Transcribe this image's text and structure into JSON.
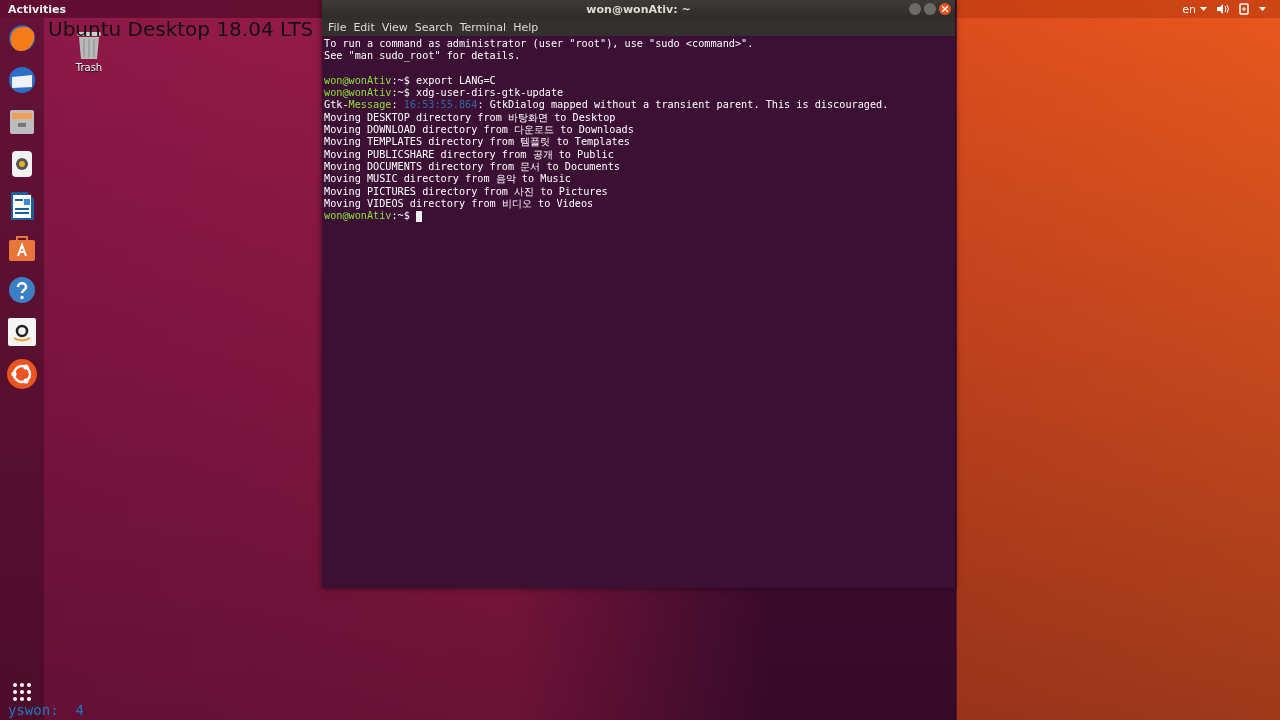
{
  "overlay": {
    "caption": "Ubuntu Desktop 18.04 LTS",
    "counter": "yswon:  4"
  },
  "top_bar": {
    "activities": "Activities",
    "language": "en"
  },
  "dock": {
    "apps": [
      {
        "kind": "firefox"
      },
      {
        "kind": "mail"
      },
      {
        "kind": "files"
      },
      {
        "kind": "music"
      },
      {
        "kind": "writer"
      },
      {
        "kind": "software"
      },
      {
        "kind": "help"
      },
      {
        "kind": "amazon"
      },
      {
        "kind": "ubuntu"
      }
    ]
  },
  "desktop": {
    "icons": [
      {
        "label": "Trash"
      }
    ]
  },
  "terminal": {
    "title": "won@wonAtiv: ~",
    "menu": [
      "File",
      "Edit",
      "View",
      "Search",
      "Terminal",
      "Help"
    ],
    "lines": [
      {
        "kind": "output",
        "segments": [
          {
            "text": "To run a command as administrator (user \"root\"), use \"sudo <command>\".",
            "kind": "plain"
          }
        ]
      },
      {
        "kind": "output",
        "segments": [
          {
            "text": "See \"man sudo_root\" for details.",
            "kind": "plain"
          }
        ]
      },
      {
        "kind": "blank"
      },
      {
        "kind": "output",
        "segments": [
          {
            "text": "won@wonAtiv",
            "kind": "user"
          },
          {
            "text": ":~$ export LANG=C",
            "kind": "plain"
          }
        ]
      },
      {
        "kind": "output",
        "segments": [
          {
            "text": "won@wonAtiv",
            "kind": "user"
          },
          {
            "text": ":~$ xdg-user-dirs-gtk-update",
            "kind": "plain"
          }
        ]
      },
      {
        "kind": "output",
        "segments": [
          {
            "text": "Gtk-",
            "kind": "plain"
          },
          {
            "text": "Message",
            "kind": "user"
          },
          {
            "text": ": ",
            "kind": "plain"
          },
          {
            "text": "16:53:55.864",
            "kind": "time"
          },
          {
            "text": ": GtkDialog mapped without a transient parent. This is discouraged.",
            "kind": "plain"
          }
        ]
      },
      {
        "kind": "output",
        "segments": [
          {
            "text": "Moving DESKTOP directory from 바탕화면 to Desktop",
            "kind": "plain"
          }
        ]
      },
      {
        "kind": "output",
        "segments": [
          {
            "text": "Moving DOWNLOAD directory from 다운로드 to Downloads",
            "kind": "plain"
          }
        ]
      },
      {
        "kind": "output",
        "segments": [
          {
            "text": "Moving TEMPLATES directory from 템플릿 to Templates",
            "kind": "plain"
          }
        ]
      },
      {
        "kind": "output",
        "segments": [
          {
            "text": "Moving PUBLICSHARE directory from 공개 to Public",
            "kind": "plain"
          }
        ]
      },
      {
        "kind": "output",
        "segments": [
          {
            "text": "Moving DOCUMENTS directory from 문서 to Documents",
            "kind": "plain"
          }
        ]
      },
      {
        "kind": "output",
        "segments": [
          {
            "text": "Moving MUSIC directory from 음악 to Music",
            "kind": "plain"
          }
        ]
      },
      {
        "kind": "output",
        "segments": [
          {
            "text": "Moving PICTURES directory from 사진 to Pictures",
            "kind": "plain"
          }
        ]
      },
      {
        "kind": "output",
        "segments": [
          {
            "text": "Moving VIDEOS directory from 비디오 to Videos",
            "kind": "plain"
          }
        ]
      },
      {
        "kind": "prompt",
        "segments": [
          {
            "text": "won@wonAtiv",
            "kind": "user"
          },
          {
            "text": ":~$ ",
            "kind": "plain"
          }
        ]
      }
    ]
  }
}
